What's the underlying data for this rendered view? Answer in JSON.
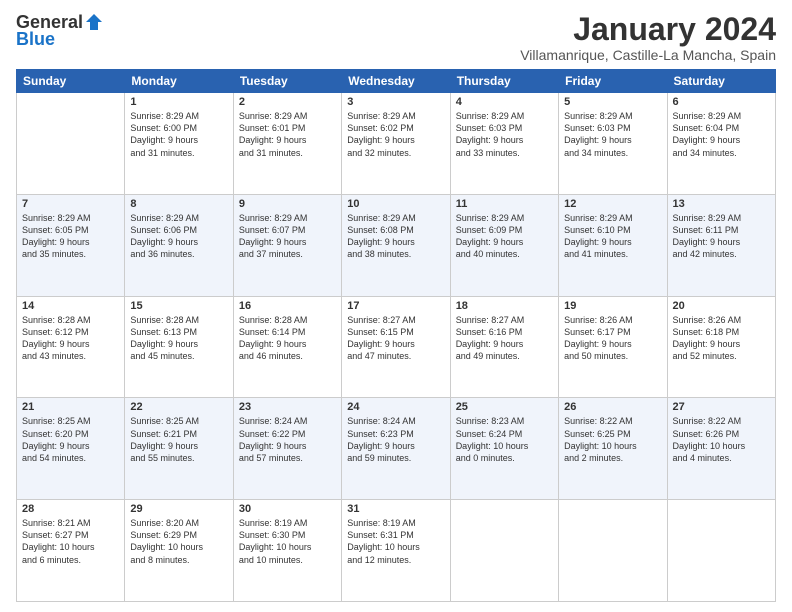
{
  "logo": {
    "general": "General",
    "blue": "Blue"
  },
  "header": {
    "month": "January 2024",
    "location": "Villamanrique, Castille-La Mancha, Spain"
  },
  "days": [
    "Sunday",
    "Monday",
    "Tuesday",
    "Wednesday",
    "Thursday",
    "Friday",
    "Saturday"
  ],
  "weeks": [
    [
      {
        "num": "",
        "lines": []
      },
      {
        "num": "1",
        "lines": [
          "Sunrise: 8:29 AM",
          "Sunset: 6:00 PM",
          "Daylight: 9 hours",
          "and 31 minutes."
        ]
      },
      {
        "num": "2",
        "lines": [
          "Sunrise: 8:29 AM",
          "Sunset: 6:01 PM",
          "Daylight: 9 hours",
          "and 31 minutes."
        ]
      },
      {
        "num": "3",
        "lines": [
          "Sunrise: 8:29 AM",
          "Sunset: 6:02 PM",
          "Daylight: 9 hours",
          "and 32 minutes."
        ]
      },
      {
        "num": "4",
        "lines": [
          "Sunrise: 8:29 AM",
          "Sunset: 6:03 PM",
          "Daylight: 9 hours",
          "and 33 minutes."
        ]
      },
      {
        "num": "5",
        "lines": [
          "Sunrise: 8:29 AM",
          "Sunset: 6:03 PM",
          "Daylight: 9 hours",
          "and 34 minutes."
        ]
      },
      {
        "num": "6",
        "lines": [
          "Sunrise: 8:29 AM",
          "Sunset: 6:04 PM",
          "Daylight: 9 hours",
          "and 34 minutes."
        ]
      }
    ],
    [
      {
        "num": "7",
        "lines": [
          "Sunrise: 8:29 AM",
          "Sunset: 6:05 PM",
          "Daylight: 9 hours",
          "and 35 minutes."
        ]
      },
      {
        "num": "8",
        "lines": [
          "Sunrise: 8:29 AM",
          "Sunset: 6:06 PM",
          "Daylight: 9 hours",
          "and 36 minutes."
        ]
      },
      {
        "num": "9",
        "lines": [
          "Sunrise: 8:29 AM",
          "Sunset: 6:07 PM",
          "Daylight: 9 hours",
          "and 37 minutes."
        ]
      },
      {
        "num": "10",
        "lines": [
          "Sunrise: 8:29 AM",
          "Sunset: 6:08 PM",
          "Daylight: 9 hours",
          "and 38 minutes."
        ]
      },
      {
        "num": "11",
        "lines": [
          "Sunrise: 8:29 AM",
          "Sunset: 6:09 PM",
          "Daylight: 9 hours",
          "and 40 minutes."
        ]
      },
      {
        "num": "12",
        "lines": [
          "Sunrise: 8:29 AM",
          "Sunset: 6:10 PM",
          "Daylight: 9 hours",
          "and 41 minutes."
        ]
      },
      {
        "num": "13",
        "lines": [
          "Sunrise: 8:29 AM",
          "Sunset: 6:11 PM",
          "Daylight: 9 hours",
          "and 42 minutes."
        ]
      }
    ],
    [
      {
        "num": "14",
        "lines": [
          "Sunrise: 8:28 AM",
          "Sunset: 6:12 PM",
          "Daylight: 9 hours",
          "and 43 minutes."
        ]
      },
      {
        "num": "15",
        "lines": [
          "Sunrise: 8:28 AM",
          "Sunset: 6:13 PM",
          "Daylight: 9 hours",
          "and 45 minutes."
        ]
      },
      {
        "num": "16",
        "lines": [
          "Sunrise: 8:28 AM",
          "Sunset: 6:14 PM",
          "Daylight: 9 hours",
          "and 46 minutes."
        ]
      },
      {
        "num": "17",
        "lines": [
          "Sunrise: 8:27 AM",
          "Sunset: 6:15 PM",
          "Daylight: 9 hours",
          "and 47 minutes."
        ]
      },
      {
        "num": "18",
        "lines": [
          "Sunrise: 8:27 AM",
          "Sunset: 6:16 PM",
          "Daylight: 9 hours",
          "and 49 minutes."
        ]
      },
      {
        "num": "19",
        "lines": [
          "Sunrise: 8:26 AM",
          "Sunset: 6:17 PM",
          "Daylight: 9 hours",
          "and 50 minutes."
        ]
      },
      {
        "num": "20",
        "lines": [
          "Sunrise: 8:26 AM",
          "Sunset: 6:18 PM",
          "Daylight: 9 hours",
          "and 52 minutes."
        ]
      }
    ],
    [
      {
        "num": "21",
        "lines": [
          "Sunrise: 8:25 AM",
          "Sunset: 6:20 PM",
          "Daylight: 9 hours",
          "and 54 minutes."
        ]
      },
      {
        "num": "22",
        "lines": [
          "Sunrise: 8:25 AM",
          "Sunset: 6:21 PM",
          "Daylight: 9 hours",
          "and 55 minutes."
        ]
      },
      {
        "num": "23",
        "lines": [
          "Sunrise: 8:24 AM",
          "Sunset: 6:22 PM",
          "Daylight: 9 hours",
          "and 57 minutes."
        ]
      },
      {
        "num": "24",
        "lines": [
          "Sunrise: 8:24 AM",
          "Sunset: 6:23 PM",
          "Daylight: 9 hours",
          "and 59 minutes."
        ]
      },
      {
        "num": "25",
        "lines": [
          "Sunrise: 8:23 AM",
          "Sunset: 6:24 PM",
          "Daylight: 10 hours",
          "and 0 minutes."
        ]
      },
      {
        "num": "26",
        "lines": [
          "Sunrise: 8:22 AM",
          "Sunset: 6:25 PM",
          "Daylight: 10 hours",
          "and 2 minutes."
        ]
      },
      {
        "num": "27",
        "lines": [
          "Sunrise: 8:22 AM",
          "Sunset: 6:26 PM",
          "Daylight: 10 hours",
          "and 4 minutes."
        ]
      }
    ],
    [
      {
        "num": "28",
        "lines": [
          "Sunrise: 8:21 AM",
          "Sunset: 6:27 PM",
          "Daylight: 10 hours",
          "and 6 minutes."
        ]
      },
      {
        "num": "29",
        "lines": [
          "Sunrise: 8:20 AM",
          "Sunset: 6:29 PM",
          "Daylight: 10 hours",
          "and 8 minutes."
        ]
      },
      {
        "num": "30",
        "lines": [
          "Sunrise: 8:19 AM",
          "Sunset: 6:30 PM",
          "Daylight: 10 hours",
          "and 10 minutes."
        ]
      },
      {
        "num": "31",
        "lines": [
          "Sunrise: 8:19 AM",
          "Sunset: 6:31 PM",
          "Daylight: 10 hours",
          "and 12 minutes."
        ]
      },
      {
        "num": "",
        "lines": []
      },
      {
        "num": "",
        "lines": []
      },
      {
        "num": "",
        "lines": []
      }
    ]
  ]
}
